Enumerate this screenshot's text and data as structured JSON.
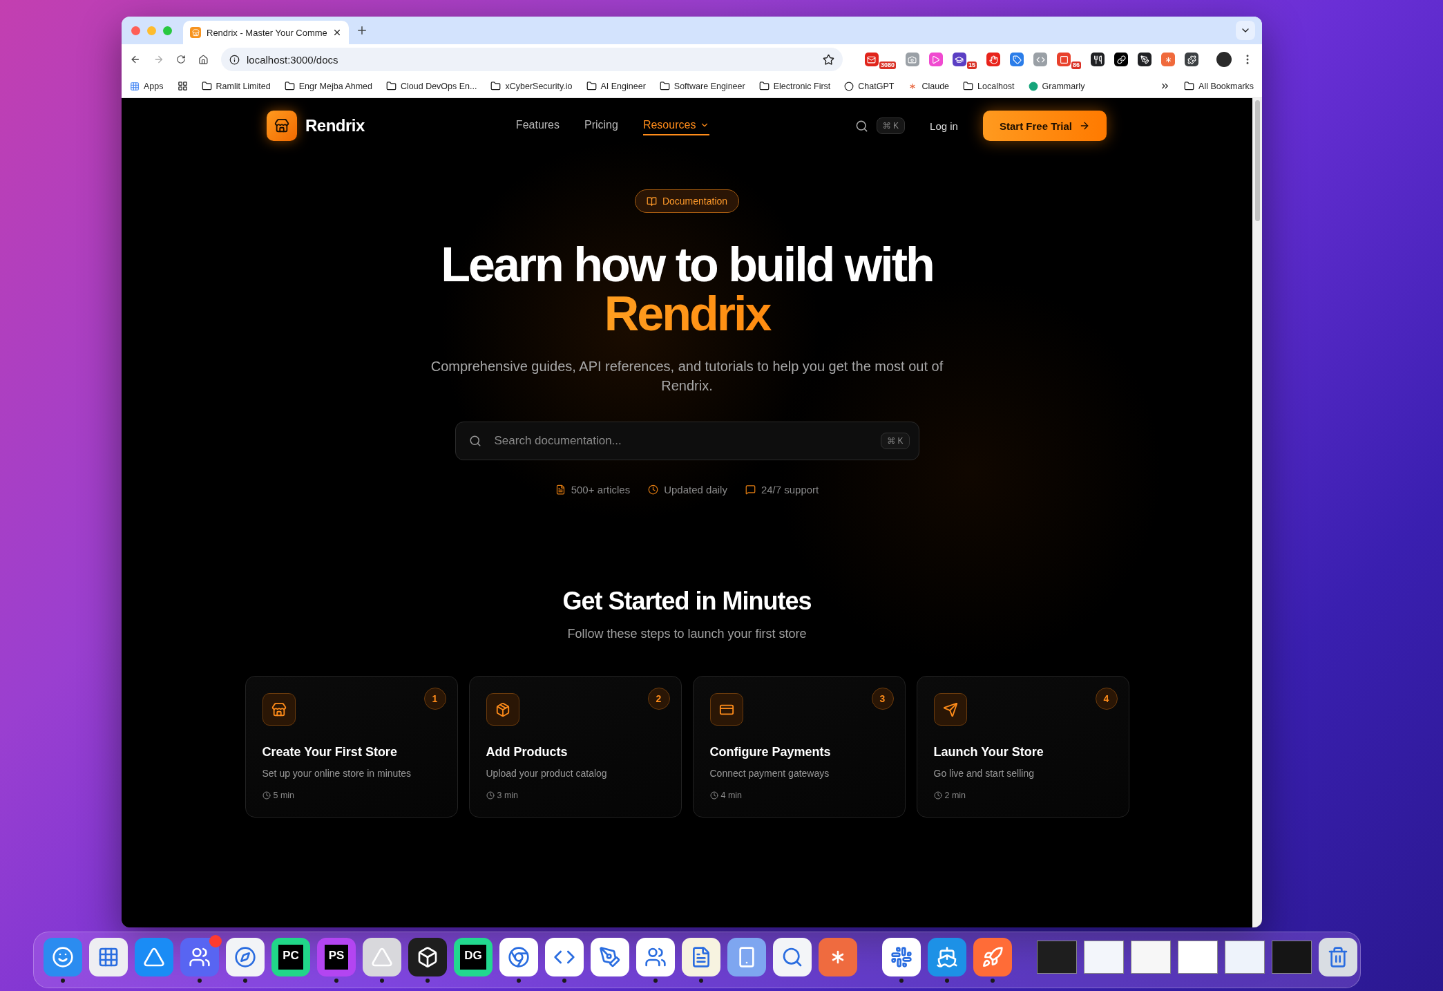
{
  "browser": {
    "tab": {
      "title": "Rendrix - Master Your Comme",
      "selected": true
    },
    "url": "localhost:3000/docs",
    "extensions": [
      {
        "kind": "mail",
        "color": "#e0241b",
        "badge": "3080"
      },
      {
        "kind": "camera",
        "color": "#9aa0a6"
      },
      {
        "kind": "play",
        "color": "#f04ad0"
      },
      {
        "kind": "cap",
        "color": "#5b3fc4",
        "badge": "15"
      },
      {
        "kind": "hand",
        "color": "#e8231b"
      },
      {
        "kind": "tag",
        "color": "#2b7de9"
      },
      {
        "kind": "code",
        "color": "#9aa0a6"
      },
      {
        "kind": "square",
        "color": "#e8412c",
        "badge": "86"
      },
      {
        "kind": "tool",
        "color": "#202124"
      },
      {
        "kind": "link",
        "color": "#000000"
      },
      {
        "kind": "pen",
        "color": "#202124"
      },
      {
        "kind": "asterisk",
        "color": "#f06a3c"
      },
      {
        "kind": "puzzle",
        "color": "#3c4043"
      }
    ],
    "bookmarks": [
      {
        "kind": "apps",
        "label": "Apps"
      },
      {
        "kind": "grid"
      },
      {
        "kind": "folder",
        "label": "Ramlit Limited"
      },
      {
        "kind": "folder",
        "label": "Engr Mejba Ahmed"
      },
      {
        "kind": "folder",
        "label": "Cloud DevOps En..."
      },
      {
        "kind": "folder",
        "label": "xCyberSecurity.io"
      },
      {
        "kind": "folder",
        "label": "AI Engineer"
      },
      {
        "kind": "folder",
        "label": "Software Engineer"
      },
      {
        "kind": "folder",
        "label": "Electronic First"
      },
      {
        "kind": "chatgpt",
        "label": "ChatGPT"
      },
      {
        "kind": "claude",
        "label": "Claude"
      },
      {
        "kind": "folder",
        "label": "Localhost"
      },
      {
        "kind": "grammarly",
        "label": "Grammarly"
      }
    ],
    "all_bookmarks": "All Bookmarks"
  },
  "page": {
    "brand": "Rendrix",
    "nav": [
      {
        "label": "Features",
        "selected": false,
        "dropdown": false
      },
      {
        "label": "Pricing",
        "selected": false,
        "dropdown": false
      },
      {
        "label": "Resources",
        "selected": true,
        "dropdown": true
      }
    ],
    "shortcut": "⌘ K",
    "login": "Log in",
    "cta": "Start Free Trial",
    "badge": "Documentation",
    "headline": "Learn how to build with",
    "headline_accent": "Rendrix",
    "subtitle": "Comprehensive guides, API references, and tutorials to help you get the most out of Rendrix.",
    "search": {
      "placeholder": "Search documentation...",
      "shortcut": "⌘ K"
    },
    "stats": [
      {
        "kind": "articles",
        "label": "500+ articles"
      },
      {
        "kind": "updated",
        "label": "Updated daily"
      },
      {
        "kind": "support",
        "label": "24/7 support"
      }
    ],
    "section_title": "Get Started in Minutes",
    "section_subtitle": "Follow these steps to launch your first store",
    "steps": [
      {
        "kind": "store",
        "number": "1",
        "title": "Create Your First Store",
        "description": "Set up your online store in minutes",
        "time": "5 min"
      },
      {
        "kind": "package",
        "number": "2",
        "title": "Add Products",
        "description": "Upload your product catalog",
        "time": "3 min"
      },
      {
        "kind": "payment",
        "number": "3",
        "title": "Configure Payments",
        "description": "Connect payment gateways",
        "time": "4 min"
      },
      {
        "kind": "launch",
        "number": "4",
        "title": "Launch Your Store",
        "description": "Go live and start selling",
        "time": "2 min"
      }
    ]
  },
  "dock": {
    "apps": [
      {
        "kind": "finder",
        "color": "#2b8cf0",
        "running": true,
        "notification": false
      },
      {
        "kind": "launchpad",
        "color": "#eeeef2",
        "running": false,
        "notification": false
      },
      {
        "kind": "appstore",
        "color": "#1a8cf5",
        "running": false,
        "notification": false
      },
      {
        "kind": "discord",
        "color": "#5865f2",
        "running": true,
        "notification": true
      },
      {
        "kind": "safari",
        "color": "#f2f4f7",
        "running": true,
        "notification": false
      },
      {
        "kind": "text",
        "label": "PC",
        "color": "#21d789",
        "running": false,
        "notification": false
      },
      {
        "kind": "text",
        "label": "PS",
        "color": "#b345f1",
        "running": true,
        "notification": false
      },
      {
        "kind": "arc",
        "color": "#d8d8dc",
        "running": true,
        "notification": false
      },
      {
        "kind": "cube",
        "color": "#1e1e1e",
        "running": true,
        "notification": false
      },
      {
        "kind": "text",
        "label": "DG",
        "color": "#22d88f",
        "running": false,
        "notification": false
      },
      {
        "kind": "chrome",
        "color": "#ffffff",
        "running": true,
        "notification": false
      },
      {
        "kind": "vscode",
        "color": "#ffffff",
        "running": true,
        "notification": false
      },
      {
        "kind": "compass",
        "color": "#ffffff",
        "running": false,
        "notification": false
      },
      {
        "kind": "teams",
        "color": "#ffffff",
        "running": true,
        "notification": false
      },
      {
        "kind": "notes",
        "color": "#f7f3e0",
        "running": true,
        "notification": false
      },
      {
        "kind": "simulator",
        "color": "#7ea6f0",
        "running": false,
        "notification": false
      },
      {
        "kind": "quicktime",
        "color": "#f3f5f8",
        "running": false,
        "notification": false
      },
      {
        "kind": "asterisk",
        "color": "#ef6b3f",
        "running": false,
        "notification": false
      }
    ],
    "recent": [
      {
        "kind": "slack",
        "color": "#ffffff",
        "running": true,
        "notification": false
      },
      {
        "kind": "docker",
        "color": "#1d91e6",
        "running": true,
        "notification": false
      },
      {
        "kind": "postman",
        "color": "#ff6c37",
        "running": true,
        "notification": false
      }
    ],
    "windows": [
      {
        "kind": "window",
        "color": "#1e1e1e"
      },
      {
        "kind": "window",
        "color": "#f3f6fb"
      },
      {
        "kind": "window",
        "color": "#f7f7f7"
      },
      {
        "kind": "window",
        "color": "#ffffff"
      },
      {
        "kind": "window",
        "color": "#eef3fb"
      },
      {
        "kind": "window",
        "color": "#151515"
      },
      {
        "kind": "trash",
        "color": "#d9dde3"
      }
    ]
  }
}
